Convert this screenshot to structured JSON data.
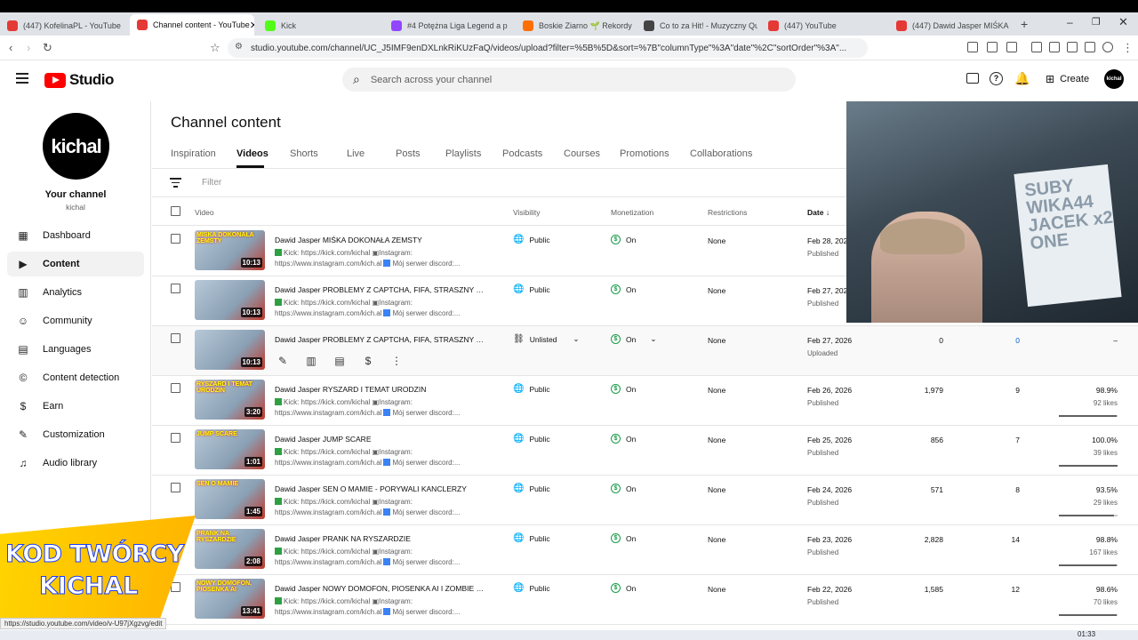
{
  "browser": {
    "tabs": [
      {
        "label": "(447) KofelinaPL - YouTube",
        "color": "#e53935"
      },
      {
        "label": "Channel content - YouTube",
        "color": "#e53935",
        "active": true
      },
      {
        "label": "Kick",
        "color": "#53fc18"
      },
      {
        "label": "#4 Potężna Liga Legend a p",
        "color": "#9146ff"
      },
      {
        "label": "Boskie Ziarno 🌱 Rekordy stre",
        "color": "#ff6f00"
      },
      {
        "label": "Co to za Hit! - Muzyczny Quiz",
        "color": "#444444"
      },
      {
        "label": "(447) YouTube",
        "color": "#e53935"
      },
      {
        "label": "(447) Dawid Jasper MIŚKA DO",
        "color": "#e53935"
      }
    ],
    "url": "studio.youtube.com/channel/UC_J5IMF9enDXLnkRiKUzFaQ/videos/upload?filter=%5B%5D&sort=%7B\"columnType\"%3A\"date\"%2C\"sortOrder\"%3A\"...",
    "status_url": "https://studio.youtube.com/video/v-U97jXgzvg/edit"
  },
  "header": {
    "logo": "Studio",
    "search_placeholder": "Search across your channel",
    "create_label": "Create",
    "avatar_text": "kichal"
  },
  "sidebar": {
    "avatar_text": "kichal",
    "your_channel": "Your channel",
    "handle": "kichal",
    "items": [
      {
        "label": "Dashboard",
        "icon": "dashboard-icon",
        "glyph": "▦"
      },
      {
        "label": "Content",
        "icon": "content-icon",
        "glyph": "▶",
        "active": true
      },
      {
        "label": "Analytics",
        "icon": "analytics-icon",
        "glyph": "▥"
      },
      {
        "label": "Community",
        "icon": "community-icon",
        "glyph": "☺"
      },
      {
        "label": "Languages",
        "icon": "languages-icon",
        "glyph": "▤"
      },
      {
        "label": "Content detection",
        "icon": "copyright-icon",
        "glyph": "©"
      },
      {
        "label": "Earn",
        "icon": "earn-icon",
        "glyph": "$"
      },
      {
        "label": "Customization",
        "icon": "customization-icon",
        "glyph": "✎"
      },
      {
        "label": "Audio library",
        "icon": "audio-library-icon",
        "glyph": "♫"
      }
    ]
  },
  "main": {
    "title": "Channel content",
    "tabs": [
      "Inspiration",
      "Videos",
      "Shorts",
      "Live",
      "Posts",
      "Playlists",
      "Podcasts",
      "Courses",
      "Promotions",
      "Collaborations"
    ],
    "filter_placeholder": "Filter",
    "columns": {
      "video": "Video",
      "visibility": "Visibility",
      "monetization": "Monetization",
      "restrictions": "Restrictions",
      "date": "Date"
    },
    "desc_line1": "Kick: https://kick.com/kichal",
    "desc_line1b": "Instagram:",
    "desc_line2": "https://www.instagram.com/kich.al",
    "desc_line2b": "Mój serwer discord:...",
    "rows": [
      {
        "title": "Dawid Jasper MIŚKA DOKONAŁA ZEMSTY",
        "duration": "10:13",
        "thumb_caption": "MIŚKA DOKONAŁA ZEMSTY",
        "visibility": "Public",
        "monetization": "On",
        "restrictions": "None",
        "date": "Feb 28, 2026",
        "date_status": "Published",
        "views": "",
        "comments": "",
        "likes_pct": "",
        "likes_count": "",
        "likes_fraction": 0
      },
      {
        "title": "Dawid Jasper PROBLEMY Z CAPTCHA, FIFA, STRASZNY MO...",
        "duration": "10:13",
        "thumb_caption": "",
        "visibility": "Public",
        "monetization": "On",
        "restrictions": "None",
        "date": "Feb 27, 2026",
        "date_status": "Published",
        "views": "",
        "comments": "",
        "likes_pct": "",
        "likes_count": "",
        "likes_fraction": 0
      },
      {
        "title": "Dawid Jasper PROBLEMY Z CAPTCHA, FIFA, STRASZNY MO...",
        "duration": "10:13",
        "thumb_caption": "",
        "visibility": "Unlisted",
        "monetization": "On",
        "restrictions": "None",
        "date": "Feb 27, 2026",
        "date_status": "Uploaded",
        "views": "0",
        "comments": "0",
        "likes_pct": "–",
        "likes_count": "",
        "likes_fraction": 0,
        "hover": true
      },
      {
        "title": "Dawid Jasper RYSZARD I TEMAT URODZIN",
        "duration": "3:20",
        "thumb_caption": "RYSZARD I TEMAT URODZIN",
        "visibility": "Public",
        "monetization": "On",
        "restrictions": "None",
        "date": "Feb 26, 2026",
        "date_status": "Published",
        "views": "1,979",
        "comments": "9",
        "likes_pct": "98.9%",
        "likes_count": "92 likes",
        "likes_fraction": 0.989
      },
      {
        "title": "Dawid Jasper JUMP SCARE",
        "duration": "1:01",
        "thumb_caption": "JUMP SCARE",
        "visibility": "Public",
        "monetization": "On",
        "restrictions": "None",
        "date": "Feb 25, 2026",
        "date_status": "Published",
        "views": "856",
        "comments": "7",
        "likes_pct": "100.0%",
        "likes_count": "39 likes",
        "likes_fraction": 1.0
      },
      {
        "title": "Dawid Jasper SEN O MAMIE - PORYWALI KANCLERZY",
        "duration": "1:45",
        "thumb_caption": "SEN O MAMIE",
        "visibility": "Public",
        "monetization": "On",
        "restrictions": "None",
        "date": "Feb 24, 2026",
        "date_status": "Published",
        "views": "571",
        "comments": "8",
        "likes_pct": "93.5%",
        "likes_count": "29 likes",
        "likes_fraction": 0.935
      },
      {
        "title": "Dawid Jasper PRANK NA RYSZARDZIE",
        "duration": "2:08",
        "thumb_caption": "PRANK NA RYSZARDZIE",
        "visibility": "Public",
        "monetization": "On",
        "restrictions": "None",
        "date": "Feb 23, 2026",
        "date_status": "Published",
        "views": "2,828",
        "comments": "14",
        "likes_pct": "98.8%",
        "likes_count": "167 likes",
        "likes_fraction": 0.988
      },
      {
        "title": "Dawid Jasper NOWY DOMOFON, PIOSENKA AI I ZOMBIE MO...",
        "duration": "13:41",
        "thumb_caption": "NOWY DOMOFON, PIOSENKA AI",
        "visibility": "Public",
        "monetization": "On",
        "restrictions": "None",
        "date": "Feb 22, 2026",
        "date_status": "Published",
        "views": "1,585",
        "comments": "12",
        "likes_pct": "98.6%",
        "likes_count": "70 likes",
        "likes_fraction": 0.986
      }
    ]
  },
  "webcam": {
    "board_text": "SUBY\nWIKA44\nJACEK x2\nONE"
  },
  "overlay": {
    "line1": "KOD TWÓRCY",
    "line2": "KICHAL"
  },
  "taskbar": {
    "time": "01:33"
  }
}
